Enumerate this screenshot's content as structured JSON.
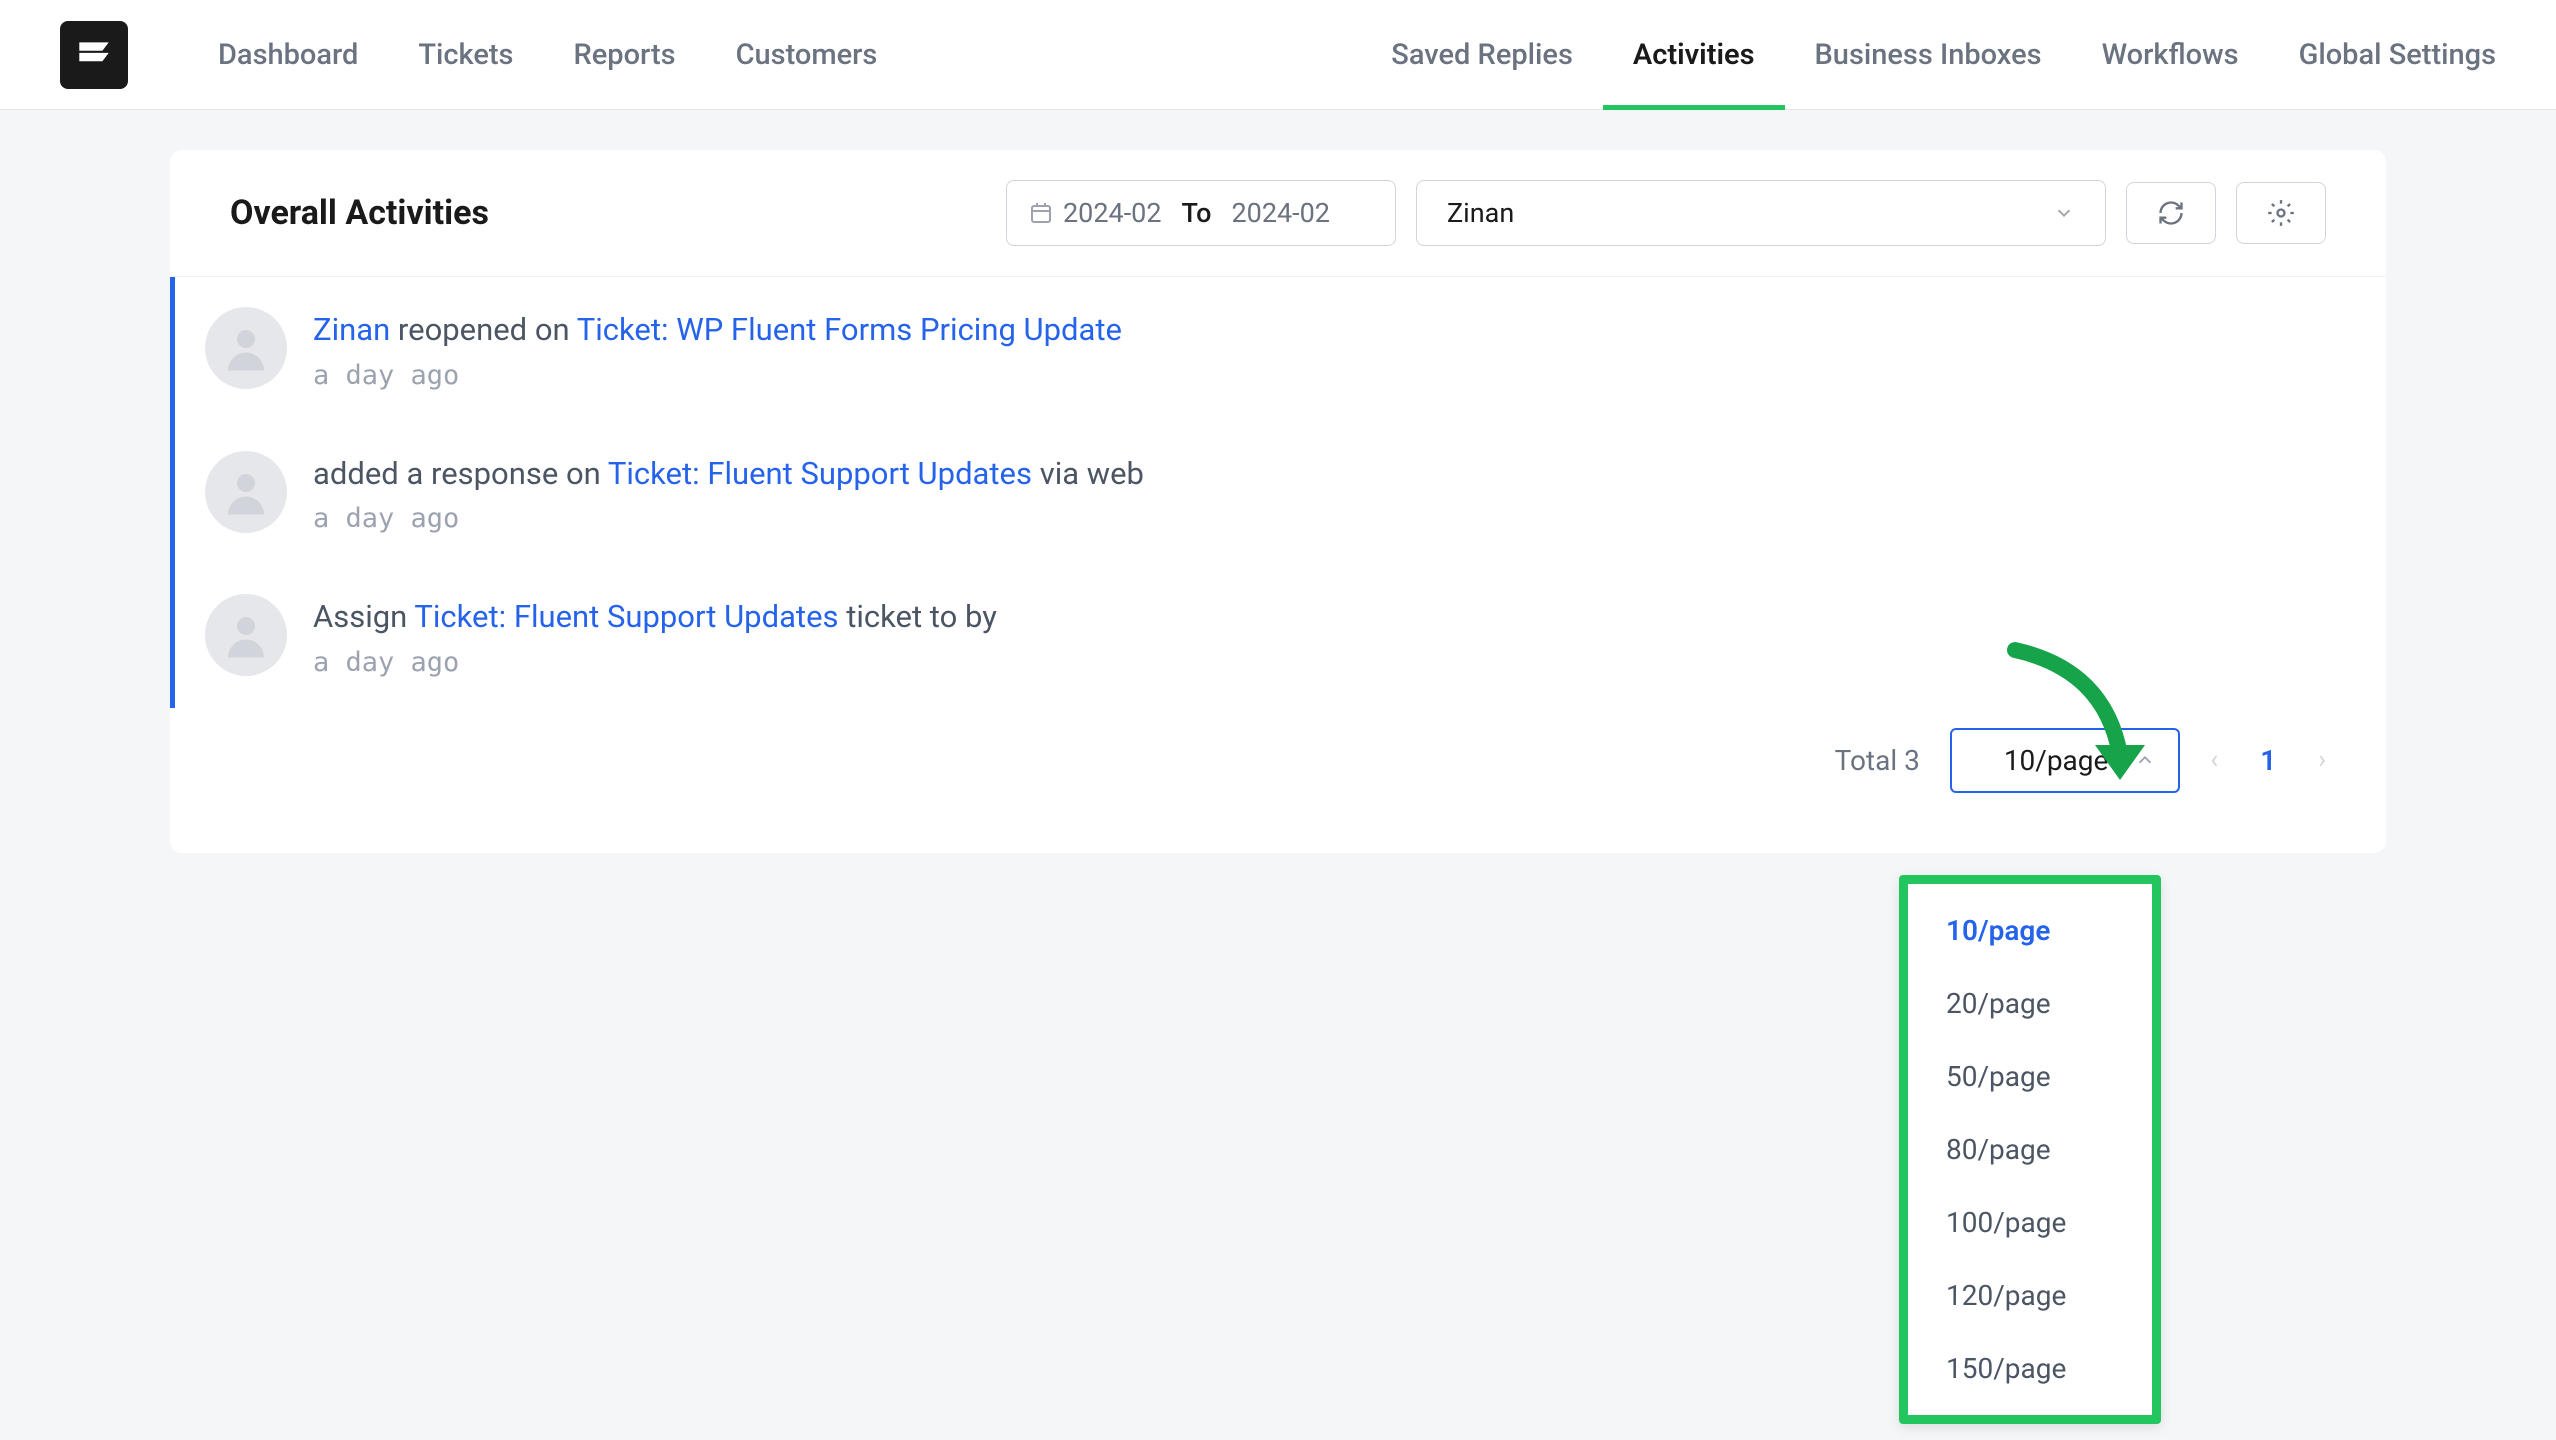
{
  "nav_left": {
    "items": [
      "Dashboard",
      "Tickets",
      "Reports",
      "Customers"
    ]
  },
  "nav_right": {
    "items": [
      "Saved Replies",
      "Activities",
      "Business Inboxes",
      "Workflows",
      "Global Settings"
    ],
    "active_index": 1
  },
  "page_title": "Overall Activities",
  "date_range": {
    "from": "2024-02",
    "to_label": "To",
    "to": "2024-02"
  },
  "user_filter": "Zinan",
  "activities": [
    {
      "user": "Zinan",
      "action": "reopened on",
      "ticket_prefix": "Ticket: ",
      "ticket": "WP Fluent Forms Pricing Update",
      "suffix": "",
      "time": "a day ago"
    },
    {
      "user": "",
      "action": "added a response on",
      "ticket_prefix": "Ticket: ",
      "ticket": "Fluent Support Updates",
      "suffix": " via web",
      "time": "a day ago"
    },
    {
      "user": "",
      "action": "Assign",
      "ticket_prefix": "Ticket: ",
      "ticket": "Fluent Support Updates",
      "suffix": " ticket to by",
      "time": "a day ago"
    }
  ],
  "pagination": {
    "total_label": "Total 3",
    "page_size": "10/page",
    "current_page": "1"
  },
  "page_size_options": [
    "10/page",
    "20/page",
    "50/page",
    "80/page",
    "100/page",
    "120/page",
    "150/page"
  ]
}
